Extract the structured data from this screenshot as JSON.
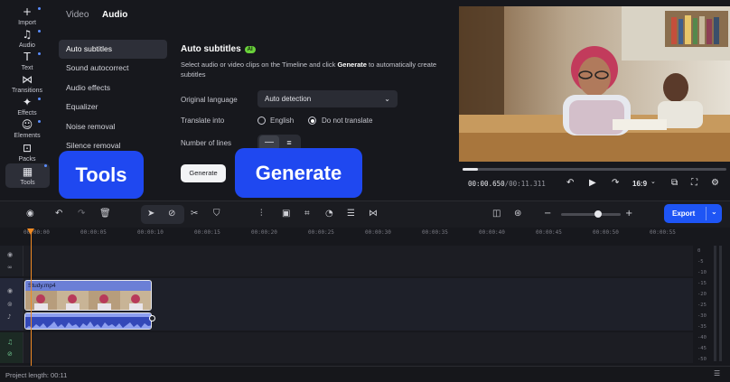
{
  "rail": {
    "items": [
      {
        "icon": "+",
        "label": "Import",
        "dot": true
      },
      {
        "icon": "♫",
        "label": "Audio",
        "dot": true
      },
      {
        "icon": "T",
        "label": "Text",
        "dot": true
      },
      {
        "icon": "⋈",
        "label": "Transitions",
        "dot": false
      },
      {
        "icon": "✦",
        "label": "Effects",
        "dot": true
      },
      {
        "icon": "☺",
        "label": "Elements",
        "dot": true
      },
      {
        "icon": "⊡",
        "label": "Packs",
        "dot": false
      },
      {
        "icon": "▦",
        "label": "Tools",
        "dot": true
      }
    ]
  },
  "tabs": {
    "video": "Video",
    "audio": "Audio"
  },
  "audio_menu": {
    "items": [
      "Auto subtitles",
      "Sound autocorrect",
      "Audio effects",
      "Equalizer",
      "Noise removal",
      "Silence removal"
    ]
  },
  "panel": {
    "title": "Auto subtitles",
    "badge": "AI",
    "description_pre": "Select audio or video clips on the Timeline and click ",
    "description_bold": "Generate",
    "description_post": " to automatically create subtitles",
    "language_label": "Original language",
    "language_value": "Auto detection",
    "translate_label": "Translate into",
    "option_english": "English",
    "option_no_translate": "Do not translate",
    "lines_label": "Number of lines",
    "generate_label": "Generate"
  },
  "callouts": {
    "tools": "Tools",
    "generate": "Generate"
  },
  "player": {
    "time_current": "00:00.650",
    "time_sep": "/",
    "time_total": "00:11.311",
    "aspect": "16:9",
    "progress": 0.057
  },
  "toolbar": {
    "export_label": "Export",
    "zoom_level": 0.62
  },
  "ruler": {
    "labels": [
      "00:00:00",
      "00:00:05",
      "00:00:10",
      "00:00:15",
      "00:00:20",
      "00:00:25",
      "00:00:30",
      "00:00:35",
      "00:00:40",
      "00:00:45",
      "00:00:50",
      "00:00:55"
    ]
  },
  "clip": {
    "name": "Study.mp4"
  },
  "vu_meter": {
    "labels": [
      "0",
      "-5",
      "-10",
      "-15",
      "-20",
      "-25",
      "-30",
      "-35",
      "-40",
      "-45",
      "-50"
    ]
  },
  "status": {
    "project_length": "Project length: 00:11"
  },
  "colors": {
    "accent": "#1e55f5",
    "callout": "#1f48f0",
    "ai_badge": "#6ad13b",
    "playhead": "#f08a24"
  }
}
